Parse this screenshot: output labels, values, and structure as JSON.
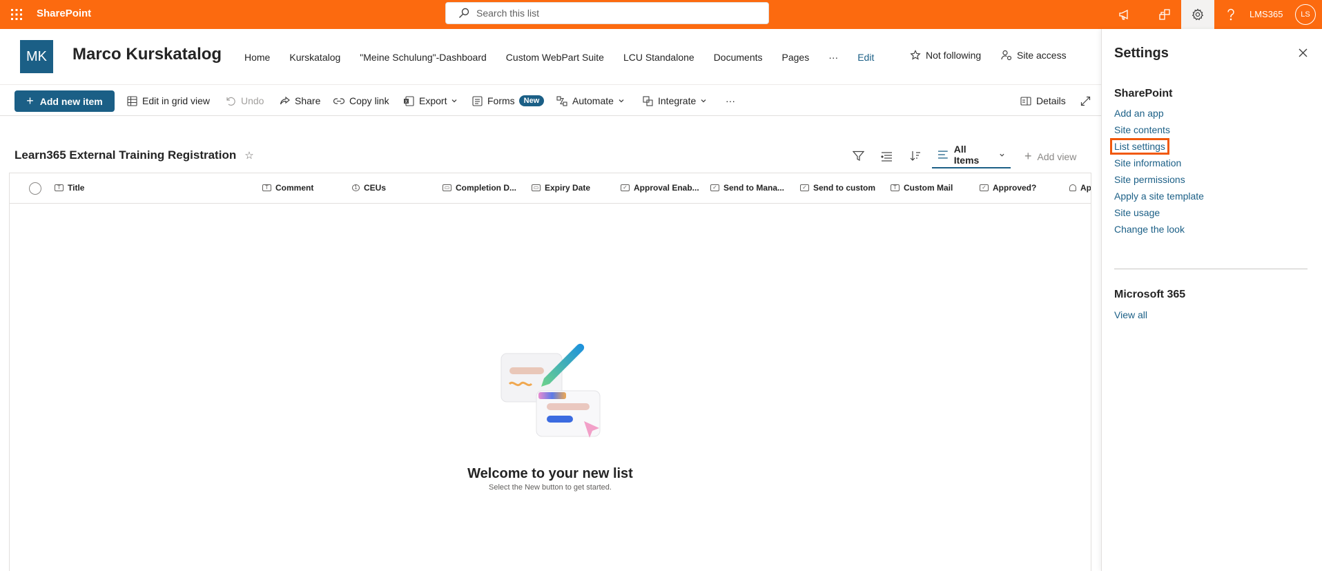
{
  "suitebar": {
    "app_name": "SharePoint",
    "search_placeholder": "Search this list",
    "user_label": "LMS365",
    "avatar_initials": "LS"
  },
  "site": {
    "logo_initials": "MK",
    "title": "Marco Kurskatalog",
    "nav": [
      "Home",
      "Kurskatalog",
      "\"Meine Schulung\"-Dashboard",
      "Custom WebPart Suite",
      "LCU Standalone",
      "Documents",
      "Pages",
      "···",
      "Edit"
    ],
    "follow_label": "Not following",
    "site_access_label": "Site access"
  },
  "commandbar": {
    "add_new": "Add new item",
    "edit_grid": "Edit in grid view",
    "undo": "Undo",
    "share": "Share",
    "copy_link": "Copy link",
    "export": "Export",
    "forms": "Forms",
    "forms_badge": "New",
    "automate": "Automate",
    "integrate": "Integrate",
    "more": "···",
    "details": "Details"
  },
  "list": {
    "title": "Learn365 External Training Registration",
    "view_name": "All Items",
    "add_view": "Add view",
    "columns": [
      "Title",
      "Comment",
      "CEUs",
      "Completion D...",
      "Expiry Date",
      "Approval Enab...",
      "Send to Mana...",
      "Send to custom",
      "Custom Mail",
      "Approved?",
      "Ap"
    ]
  },
  "empty_state": {
    "title": "Welcome to your new list",
    "subtitle": "Select the New button to get started."
  },
  "settings_panel": {
    "title": "Settings",
    "section_sharepoint": "SharePoint",
    "links": [
      "Add an app",
      "Site contents",
      "List settings",
      "Site information",
      "Site permissions",
      "Apply a site template",
      "Site usage",
      "Change the look"
    ],
    "section_m365": "Microsoft 365",
    "view_all": "View all"
  },
  "colors": {
    "suitebar": "#fc6a0f",
    "accent": "#1b5f86",
    "highlight": "#f1580b"
  }
}
